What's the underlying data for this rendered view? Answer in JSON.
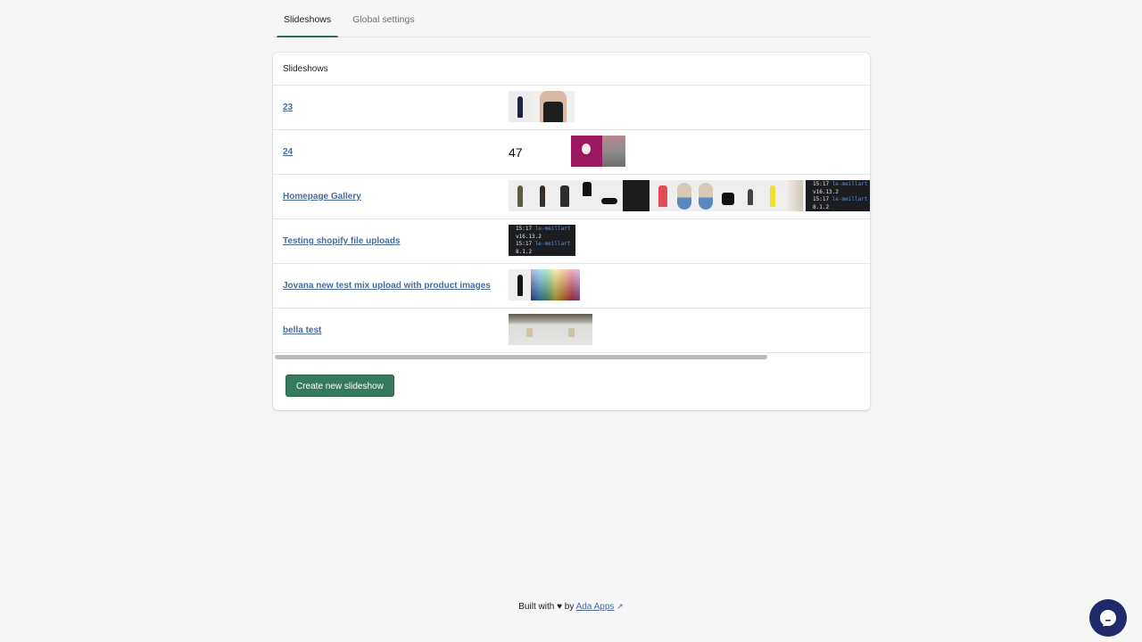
{
  "tabs": [
    {
      "label": "Slideshows",
      "active": true
    },
    {
      "label": "Global settings",
      "active": false
    }
  ],
  "card": {
    "title": "Slideshows",
    "rows": [
      {
        "name": "23",
        "thumbnails": [
          "woman-navy-dress-back",
          "woman-black-top-back"
        ]
      },
      {
        "name": "24",
        "thumbnails": [
          "text-47",
          "magenta-lightbulb",
          "street-photo"
        ],
        "text_fragment": "47"
      },
      {
        "name": "Homepage Gallery",
        "thumbnails": [
          "woman-khaki-skirt",
          "man-brown-outfit",
          "man-black-jacket",
          "black-skirt",
          "black-shoes",
          "black-pants-pocket",
          "woman-red-jacket",
          "blue-tan-flats",
          "black-boot",
          "woman-sitting",
          "yellow-dress",
          "beige-fabric",
          "terminal-screenshot"
        ]
      },
      {
        "name": "Testing shopify file uploads",
        "thumbnails": [
          "terminal-screenshot"
        ]
      },
      {
        "name": "Jovana new test mix upload with product images",
        "thumbnails": [
          "woman-black-dress",
          "color-palette"
        ]
      },
      {
        "name": "bella test",
        "thumbnails": [
          "snow-scene",
          "snow-scene"
        ]
      }
    ],
    "terminal_lines": [
      {
        "time": "15:17",
        "host": "le-meillart"
      },
      {
        "text": "v16.13.2"
      },
      {
        "time": "15:17",
        "host": "le-meillart"
      },
      {
        "text": "8.1.2"
      }
    ],
    "create_button": "Create new slideshow"
  },
  "footer": {
    "prefix": "Built with",
    "heart_icon": "heart-icon",
    "by": "by",
    "link": "Ada Apps",
    "link_icon": "external-link-icon"
  },
  "chat": {
    "icon": "chat-bubble-icon"
  },
  "colors": {
    "accent": "#367a5e",
    "link": "#4a6c9b",
    "chat": "#1f2a6b",
    "background": "#f6f6f7"
  }
}
